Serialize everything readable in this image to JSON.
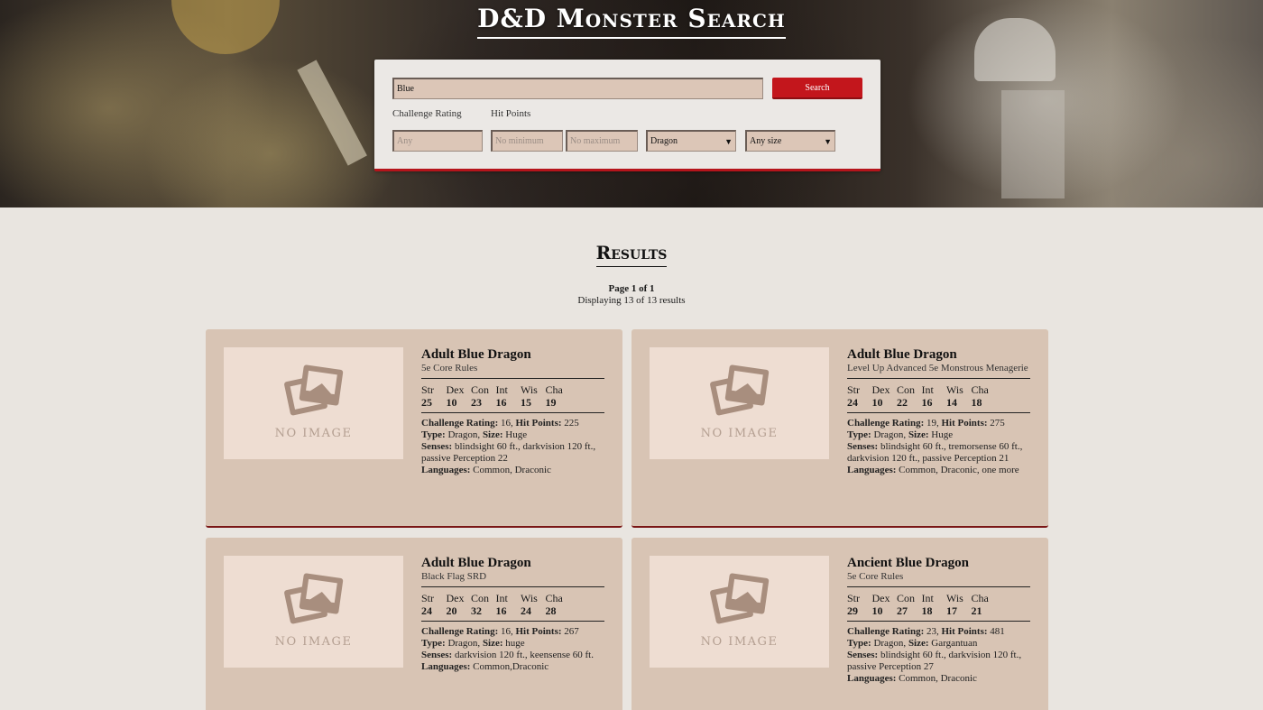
{
  "app": {
    "title": "D&D Monster Search"
  },
  "search": {
    "query_value": "Blue",
    "button_label": "Search",
    "challenge_rating_label": "Challenge Rating",
    "hit_points_label": "Hit Points",
    "cr_placeholder": "Any",
    "hp_min_placeholder": "No minimum",
    "hp_max_placeholder": "No maximum",
    "type_selected": "Dragon",
    "size_selected": "Any size"
  },
  "results": {
    "heading": "Results",
    "page_info": "Page 1 of 1",
    "display_info": "Displaying 13 of 13 results",
    "no_image_label": "NO IMAGE",
    "stat_names": [
      "Str",
      "Dex",
      "Con",
      "Int",
      "Wis",
      "Cha"
    ],
    "cards": [
      {
        "name": "Adult Blue Dragon",
        "source": "5e Core Rules",
        "stats": [
          "25",
          "10",
          "23",
          "16",
          "15",
          "19"
        ],
        "cr_label": "Challenge Rating:",
        "cr": " 16, ",
        "hp_label": "Hit Points:",
        "hp": " 225",
        "type_label": "Type:",
        "type": " Dragon, ",
        "size_label": "Size:",
        "size": " Huge",
        "senses_label": "Senses:",
        "senses": " blindsight 60 ft., darkvision 120 ft., passive Perception 22",
        "languages_label": "Languages:",
        "languages": " Common, Draconic"
      },
      {
        "name": "Adult Blue Dragon",
        "source": "Level Up Advanced 5e Monstrous Menagerie",
        "stats": [
          "24",
          "10",
          "22",
          "16",
          "14",
          "18"
        ],
        "cr_label": "Challenge Rating:",
        "cr": " 19, ",
        "hp_label": "Hit Points:",
        "hp": " 275",
        "type_label": "Type:",
        "type": " Dragon, ",
        "size_label": "Size:",
        "size": " Huge",
        "senses_label": "Senses:",
        "senses": " blindsight 60 ft., tremorsense 60 ft., darkvision 120 ft., passive Perception 21",
        "languages_label": "Languages:",
        "languages": " Common, Draconic, one more"
      },
      {
        "name": "Adult Blue Dragon",
        "source": "Black Flag SRD",
        "stats": [
          "24",
          "20",
          "32",
          "16",
          "24",
          "28"
        ],
        "cr_label": "Challenge Rating:",
        "cr": " 16, ",
        "hp_label": "Hit Points:",
        "hp": " 267",
        "type_label": "Type:",
        "type": " Dragon, ",
        "size_label": "Size:",
        "size": " huge",
        "senses_label": "Senses:",
        "senses": " darkvision 120 ft., keensense 60 ft.",
        "languages_label": "Languages:",
        "languages": " Common,Draconic"
      },
      {
        "name": "Ancient Blue Dragon",
        "source": "5e Core Rules",
        "stats": [
          "29",
          "10",
          "27",
          "18",
          "17",
          "21"
        ],
        "cr_label": "Challenge Rating:",
        "cr": " 23, ",
        "hp_label": "Hit Points:",
        "hp": " 481",
        "type_label": "Type:",
        "type": " Dragon, ",
        "size_label": "Size:",
        "size": " Gargantuan",
        "senses_label": "Senses:",
        "senses": " blindsight 60 ft., darkvision 120 ft., passive Perception 27",
        "languages_label": "Languages:",
        "languages": " Common, Draconic"
      }
    ]
  },
  "colors": {
    "accent": "#c3161c",
    "card_bg": "#d8c4b4",
    "page_bg": "#e9e5e0"
  }
}
